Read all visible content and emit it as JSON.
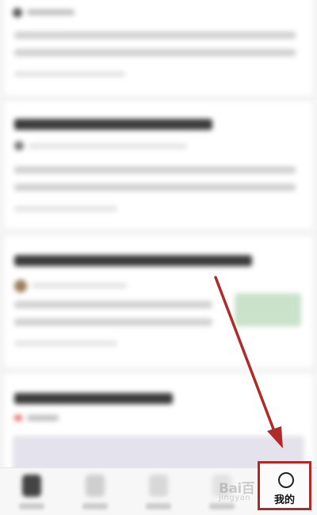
{
  "bottom_nav": {
    "mine_label": "我的"
  },
  "watermark": {
    "text": "Bai百",
    "sub": "jingyan"
  },
  "colors": {
    "highlight_box": "#b12828",
    "arrow": "#b02a2a",
    "feed_background": "#f4f4f4",
    "card_background": "#ffffff"
  },
  "icons": {
    "mine_tab": "person-icon"
  }
}
